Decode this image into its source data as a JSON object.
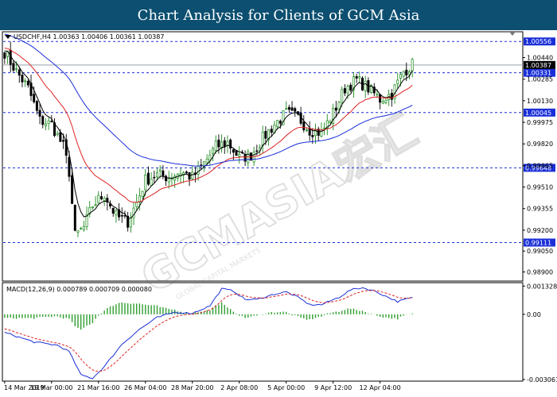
{
  "header": {
    "title": "Chart Analysis for Clients of GCM Asia"
  },
  "watermark": {
    "text": "GCMASIA宏汇",
    "sub": "GLOBAL CAPITAL MARKETS"
  },
  "colors": {
    "banner": "#0c4f70",
    "bull": "#1e8c1e",
    "bear": "#000000",
    "ma_fast": "#000000",
    "ma_mid": "#dd2222",
    "ma_slow": "#1a2fd8",
    "level": "#1a2fd8",
    "macd_hist": "#2f9e2f",
    "macd_line": "#1a2fd8",
    "macd_signal": "#dd2222"
  },
  "chart_data": {
    "type": "candlestick",
    "symbol_info": "USDCHF,H4  1.00363 1.00406 1.00361 1.00387",
    "price_axis": {
      "ylim": [
        0.9884,
        1.0062
      ],
      "tick_labels": [
        "1.00440",
        "1.00285",
        "1.00130",
        "0.99975",
        "0.99820",
        "0.99665",
        "0.99510",
        "0.99355",
        "0.99200",
        "0.99050",
        "0.98900"
      ],
      "tick_values": [
        1.0044,
        1.00285,
        1.0013,
        0.99975,
        0.9982,
        0.99665,
        0.9951,
        0.99355,
        0.992,
        0.9905,
        0.989
      ]
    },
    "time_axis": {
      "labels": [
        "14 Mar 2019",
        "19 Mar 00:00",
        "21 Mar 16:00",
        "26 Mar 04:00",
        "28 Mar 20:00",
        "2 Apr 08:00",
        "5 Apr 00:00",
        "9 Apr 12:00",
        "12 Apr 04:00"
      ],
      "label_bar_index": [
        0,
        16,
        32,
        48,
        64,
        80,
        96,
        112,
        128
      ]
    },
    "levels": [
      {
        "value": 1.00556,
        "label": "1.00556"
      },
      {
        "value": 1.00331,
        "label": "1.00331"
      },
      {
        "value": 1.00045,
        "label": "1.00045"
      },
      {
        "value": 0.99648,
        "label": "0.99648"
      },
      {
        "value": 0.99111,
        "label": "0.99111"
      }
    ],
    "current_price": {
      "value": 1.00387,
      "label": "1.00387"
    },
    "anchors": [
      [
        0,
        1.0048
      ],
      [
        4,
        1.0034
      ],
      [
        8,
        1.0022
      ],
      [
        12,
        0.9999
      ],
      [
        16,
        0.9996
      ],
      [
        20,
        0.998
      ],
      [
        22,
        0.9962
      ],
      [
        24,
        0.9916
      ],
      [
        27,
        0.9922
      ],
      [
        30,
        0.9938
      ],
      [
        34,
        0.9946
      ],
      [
        38,
        0.993
      ],
      [
        42,
        0.9926
      ],
      [
        45,
        0.994
      ],
      [
        48,
        0.9956
      ],
      [
        52,
        0.996
      ],
      [
        56,
        0.9958
      ],
      [
        60,
        0.9962
      ],
      [
        64,
        0.9958
      ],
      [
        68,
        0.9968
      ],
      [
        72,
        0.998
      ],
      [
        76,
        0.9983
      ],
      [
        80,
        0.9972
      ],
      [
        84,
        0.9974
      ],
      [
        88,
        0.9986
      ],
      [
        92,
        0.9996
      ],
      [
        96,
        1.0004
      ],
      [
        100,
        1.0001
      ],
      [
        104,
        0.9992
      ],
      [
        108,
        0.999
      ],
      [
        112,
        1.0004
      ],
      [
        116,
        1.0022
      ],
      [
        120,
        1.0028
      ],
      [
        124,
        1.0022
      ],
      [
        128,
        1.0014
      ],
      [
        132,
        1.0018
      ],
      [
        136,
        1.0034
      ],
      [
        139,
        1.0039
      ]
    ],
    "moving_averages": [
      {
        "period": 5,
        "color": "#000000"
      },
      {
        "period": 20,
        "color": "#dd2222"
      },
      {
        "period": 55,
        "color": "#1a2fd8"
      }
    ],
    "macd": {
      "label": "MACD(12,26,9) 0.000789 0.000709 0.000080",
      "ylim": [
        -0.0031,
        0.00145
      ],
      "tick_labels": [
        "0.001328",
        "0.00",
        "-0.003061"
      ],
      "tick_values": [
        0.001328,
        0.0,
        -0.003061
      ],
      "line_anchors": [
        [
          0,
          -0.00085
        ],
        [
          10,
          -0.0013
        ],
        [
          18,
          -0.00145
        ],
        [
          22,
          -0.00175
        ],
        [
          26,
          -0.00285
        ],
        [
          30,
          -0.003
        ],
        [
          34,
          -0.00245
        ],
        [
          40,
          -0.0014
        ],
        [
          46,
          -0.0007
        ],
        [
          52,
          -0.00015
        ],
        [
          58,
          0.0001
        ],
        [
          64,
          5e-05
        ],
        [
          70,
          0.0004
        ],
        [
          74,
          0.0012
        ],
        [
          78,
          0.0011
        ],
        [
          82,
          0.0007
        ],
        [
          86,
          0.0007
        ],
        [
          92,
          0.00095
        ],
        [
          96,
          0.00105
        ],
        [
          100,
          0.0008
        ],
        [
          104,
          0.00045
        ],
        [
          108,
          0.00045
        ],
        [
          114,
          0.0008
        ],
        [
          118,
          0.00115
        ],
        [
          122,
          0.00125
        ],
        [
          126,
          0.0011
        ],
        [
          130,
          0.00085
        ],
        [
          134,
          0.0006
        ],
        [
          139,
          0.00079
        ]
      ]
    }
  }
}
